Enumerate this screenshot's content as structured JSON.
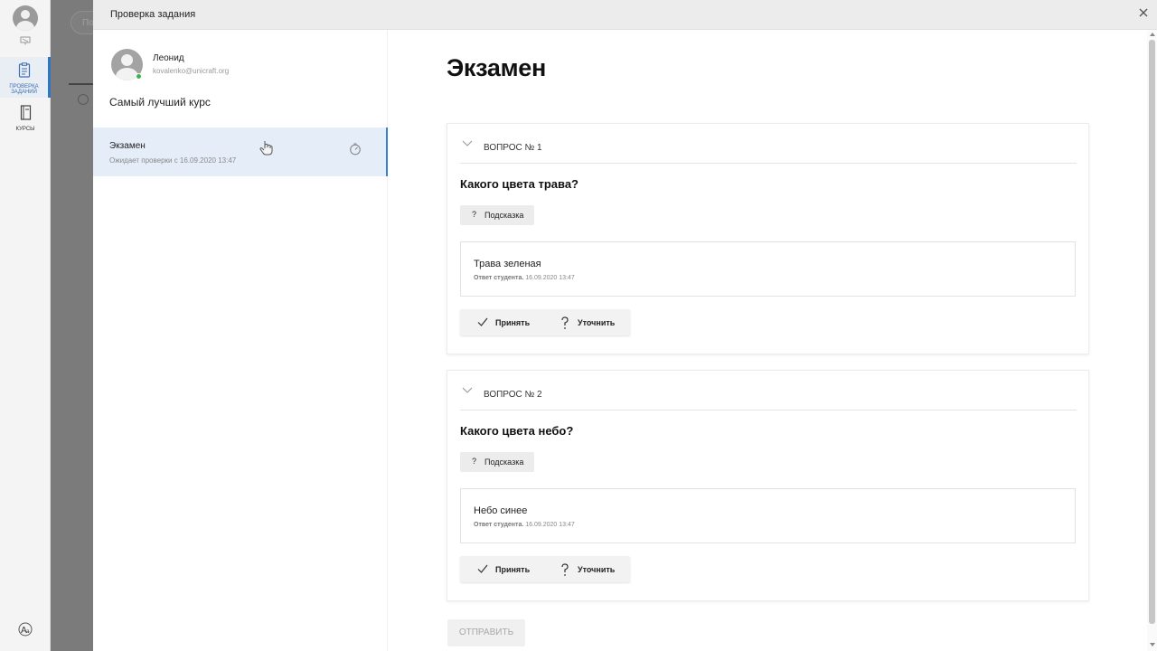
{
  "rail": {
    "items": [
      {
        "label": "ПРОВЕРКА ЗАДАНИЙ",
        "active": true
      },
      {
        "label": "КУРСЫ",
        "active": false
      }
    ]
  },
  "background": {
    "search_placeholder": "По"
  },
  "dialog": {
    "title": "Проверка задания"
  },
  "student": {
    "name": "Леонид",
    "email": "kovalenko@unicraft.org",
    "course": "Самый лучший курс"
  },
  "tasks": [
    {
      "name": "Экзамен",
      "status": "Ожидает проверки с 16.09.2020 13:47"
    }
  ],
  "exam": {
    "title": "Экзамен",
    "hint_label": "Подсказка",
    "hint_symbol": "?",
    "answer_meta_label": "Ответ студента.",
    "accept_label": "Принять",
    "clarify_label": "Уточнить",
    "submit_label": "ОТПРАВИТЬ",
    "questions": [
      {
        "number": "ВОПРОС № 1",
        "text": "Какого цвета трава?",
        "answer": "Трава зеленая",
        "answer_date": "16.09.2020 13:47"
      },
      {
        "number": "ВОПРОС № 2",
        "text": "Какого цвета небо?",
        "answer": "Небо синее",
        "answer_date": "16.09.2020 13:47"
      }
    ]
  },
  "colors": {
    "accent": "#3b7fcf",
    "selected_bg": "#e4edf8",
    "online": "#3db54a"
  },
  "icons": [
    "user-icon",
    "presentation-icon",
    "clipboard-icon",
    "book-icon",
    "font-size-icon",
    "close-icon",
    "timer-icon",
    "hand-cursor-icon",
    "chevron-down-icon",
    "check-icon",
    "question-icon"
  ]
}
